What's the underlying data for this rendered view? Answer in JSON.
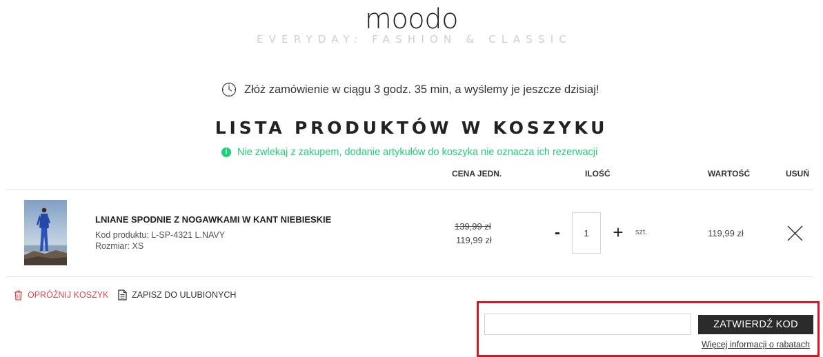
{
  "brand": {
    "logo": "moodo",
    "tagline": "EVERYDAY: FASHION & CLASSIC"
  },
  "shipping_notice": {
    "icon": "clock-icon",
    "text": "Złóż zamówienie w ciągu 3 godz. 35 min, a wyślemy je jeszcze dzisiaj!"
  },
  "cart": {
    "title": "LISTA PRODUKTÓW W KOSZYKU",
    "notice": {
      "icon": "info-icon",
      "icon_glyph": "i",
      "text": "Nie zwlekaj z zakupem, dodanie artykułów do koszyka nie oznacza ich rezerwacji",
      "color": "#1ecf7a"
    },
    "columns": {
      "unit_price": "CENA JEDN.",
      "quantity": "ILOŚĆ",
      "total": "WARTOŚĆ",
      "remove": "USUŃ"
    },
    "items": [
      {
        "name": "LNIANE SPODNIE Z NOGAWKAMI W KANT NIEBIESKIE",
        "code_line": "Kod produktu: L-SP-4321 L.NAVY",
        "size_line": "Rozmiar: XS",
        "price_old": "139,99 zł",
        "price_new": "119,99 zł",
        "qty_minus": "-",
        "qty_value": "1",
        "qty_plus": "+",
        "qty_unit": "szt.",
        "line_total": "119,99 zł"
      }
    ],
    "actions": {
      "empty_cart": "OPRÓŻNIJ KOSZYK",
      "empty_cart_color": "#e0474c",
      "save_favorites": "ZAPISZ DO ULUBIONYCH"
    }
  },
  "coupon": {
    "input_value": "",
    "button_label": "ZATWIERDŹ KOD",
    "info_link": "Więcej informacji o rabatach",
    "highlight_color": "#e3111f"
  }
}
